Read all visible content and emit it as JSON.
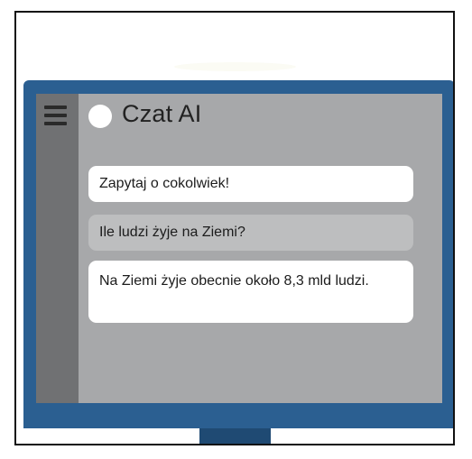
{
  "app": {
    "title": "Czat AI"
  },
  "chat": {
    "prompt_placeholder": "Zapytaj o cokolwiek!",
    "question": "Ile ludzi żyje na Ziemi?",
    "answer": "Na Ziemi żyje obecnie około 8,3 mld ludzi."
  },
  "icons": {
    "menu": "hamburger-menu-icon",
    "status": "status-dot-icon"
  },
  "colors": {
    "bezel": "#2b5f91",
    "screen": "#a7a8aa",
    "sidebar": "#707173",
    "question_bubble": "#bdbebf"
  }
}
